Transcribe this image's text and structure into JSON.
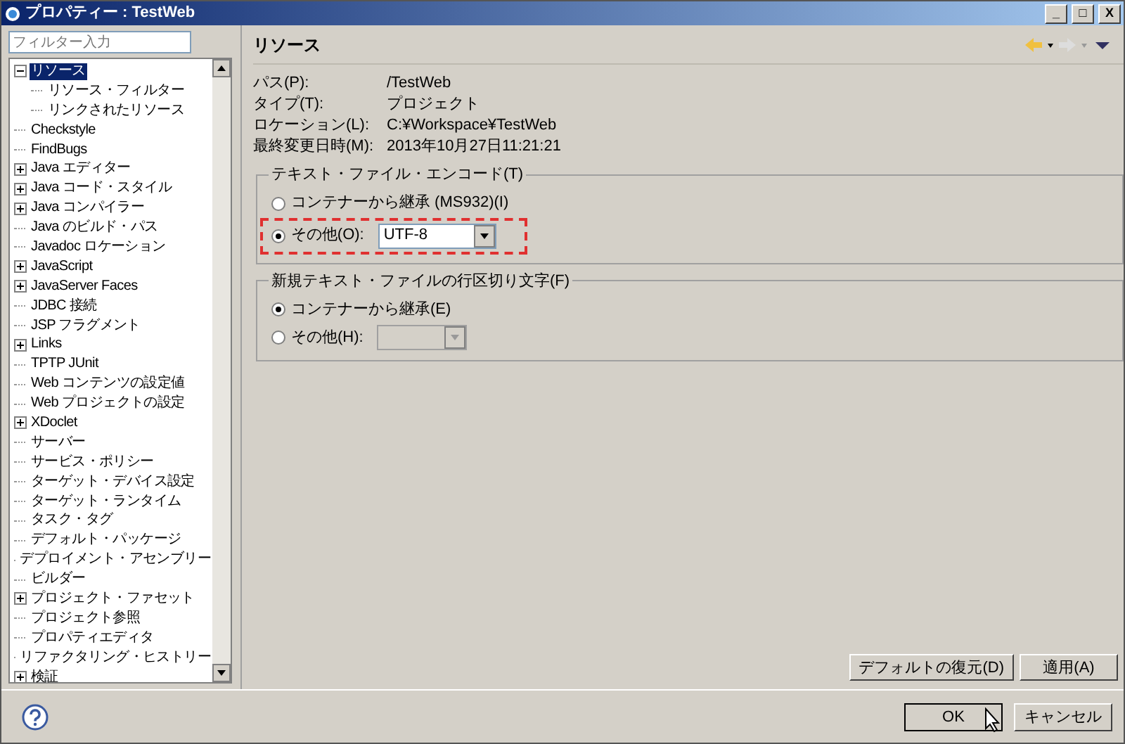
{
  "window": {
    "title": "プロパティー : TestWeb",
    "controls": [
      "_",
      "□",
      "X"
    ]
  },
  "filter": {
    "placeholder": "フィルター入力"
  },
  "tree": [
    {
      "label": "リソース",
      "selected": true,
      "expanded": true,
      "children": [
        {
          "label": "リソース・フィルター",
          "selected": false
        },
        {
          "label": "リンクされたリソース",
          "selected": false
        }
      ]
    },
    {
      "label": "Checkstyle",
      "selected": false
    },
    {
      "label": "FindBugs",
      "selected": false
    },
    {
      "label": "Java エディター",
      "selected": false,
      "expanded": false
    },
    {
      "label": "Java コード・スタイル",
      "selected": false,
      "expanded": false
    },
    {
      "label": "Java コンパイラー",
      "selected": false,
      "expanded": false
    },
    {
      "label": "Java のビルド・パス",
      "selected": false
    },
    {
      "label": "Javadoc ロケーション",
      "selected": false
    },
    {
      "label": "JavaScript",
      "selected": false,
      "expanded": false
    },
    {
      "label": "JavaServer Faces",
      "selected": false,
      "expanded": false
    },
    {
      "label": "JDBC 接続",
      "selected": false
    },
    {
      "label": "JSP フラグメント",
      "selected": false
    },
    {
      "label": "Links",
      "selected": false,
      "expanded": false
    },
    {
      "label": "TPTP JUnit",
      "selected": false
    },
    {
      "label": "Web コンテンツの設定値",
      "selected": false
    },
    {
      "label": "Web プロジェクトの設定",
      "selected": false
    },
    {
      "label": "XDoclet",
      "selected": false,
      "expanded": false
    },
    {
      "label": "サーバー",
      "selected": false
    },
    {
      "label": "サービス・ポリシー",
      "selected": false
    },
    {
      "label": "ターゲット・デバイス設定",
      "selected": false
    },
    {
      "label": "ターゲット・ランタイム",
      "selected": false
    },
    {
      "label": "タスク・タグ",
      "selected": false
    },
    {
      "label": "デフォルト・パッケージ",
      "selected": false
    },
    {
      "label": "デプロイメント・アセンブリー",
      "selected": false
    },
    {
      "label": "ビルダー",
      "selected": false
    },
    {
      "label": "プロジェクト・ファセット",
      "selected": false,
      "expanded": false
    },
    {
      "label": "プロジェクト参照",
      "selected": false
    },
    {
      "label": "プロパティエディタ",
      "selected": false
    },
    {
      "label": "リファクタリング・ヒストリー",
      "selected": false
    },
    {
      "label": "検証",
      "selected": false,
      "expanded": false
    }
  ],
  "page": {
    "title": "リソース",
    "properties": [
      {
        "label": "パス(P):",
        "value": "/TestWeb"
      },
      {
        "label": "タイプ(T):",
        "value": "プロジェクト"
      },
      {
        "label": "ロケーション(L):",
        "value": "C:¥Workspace¥TestWeb"
      },
      {
        "label": "最終変更日時(M):",
        "value": "2013年10月27日11:21:21"
      }
    ],
    "groups": [
      {
        "title": "テキスト・ファイル・エンコード(T)",
        "options": [
          {
            "label": "コンテナーから継承 (MS932)(I)",
            "selected": false
          },
          {
            "label": "その他(O):",
            "selected": true,
            "combo": {
              "value": "UTF-8",
              "disabled": false
            },
            "highlighted": true
          }
        ]
      },
      {
        "title": "新規テキスト・ファイルの行区切り文字(F)",
        "options": [
          {
            "label": "コンテナーから継承(E)",
            "selected": true
          },
          {
            "label": "その他(H):",
            "selected": false,
            "combo": {
              "disabled": true
            },
            "highlighted": false
          }
        ]
      }
    ],
    "buttons": [
      "デフォルトの復元(D)",
      "適用(A)"
    ]
  },
  "dialog_buttons": [
    "OK",
    "キャンセル"
  ]
}
